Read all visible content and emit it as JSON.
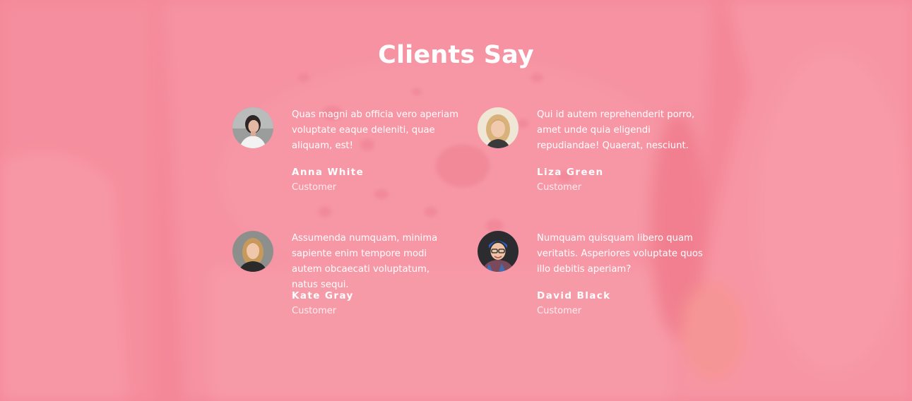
{
  "section": {
    "title": "Clients Say",
    "overlay_color": "#f78c9d"
  },
  "testimonials": [
    {
      "quote": "Quas magni ab officia vero aperiam voluptate eaque deleniti, quae aliquam, est!",
      "name": "Anna White",
      "role": "Customer",
      "avatar": "avatar-anna-white"
    },
    {
      "quote": "Qui id autem reprehenderit porro, amet unde quia eligendi repudiandae! Quaerat, nesciunt.",
      "name": "Liza Green",
      "role": "Customer",
      "avatar": "avatar-liza-green"
    },
    {
      "quote": "Assumenda numquam, minima sapiente enim tempore modi autem obcaecati voluptatum, natus sequi.",
      "name": "Kate Gray",
      "role": "Customer",
      "avatar": "avatar-kate-gray"
    },
    {
      "quote": "Numquam quisquam libero quam veritatis. Asperiores voluptate quos illo debitis aperiam?",
      "name": "David Black",
      "role": "Customer",
      "avatar": "avatar-david-black"
    }
  ]
}
